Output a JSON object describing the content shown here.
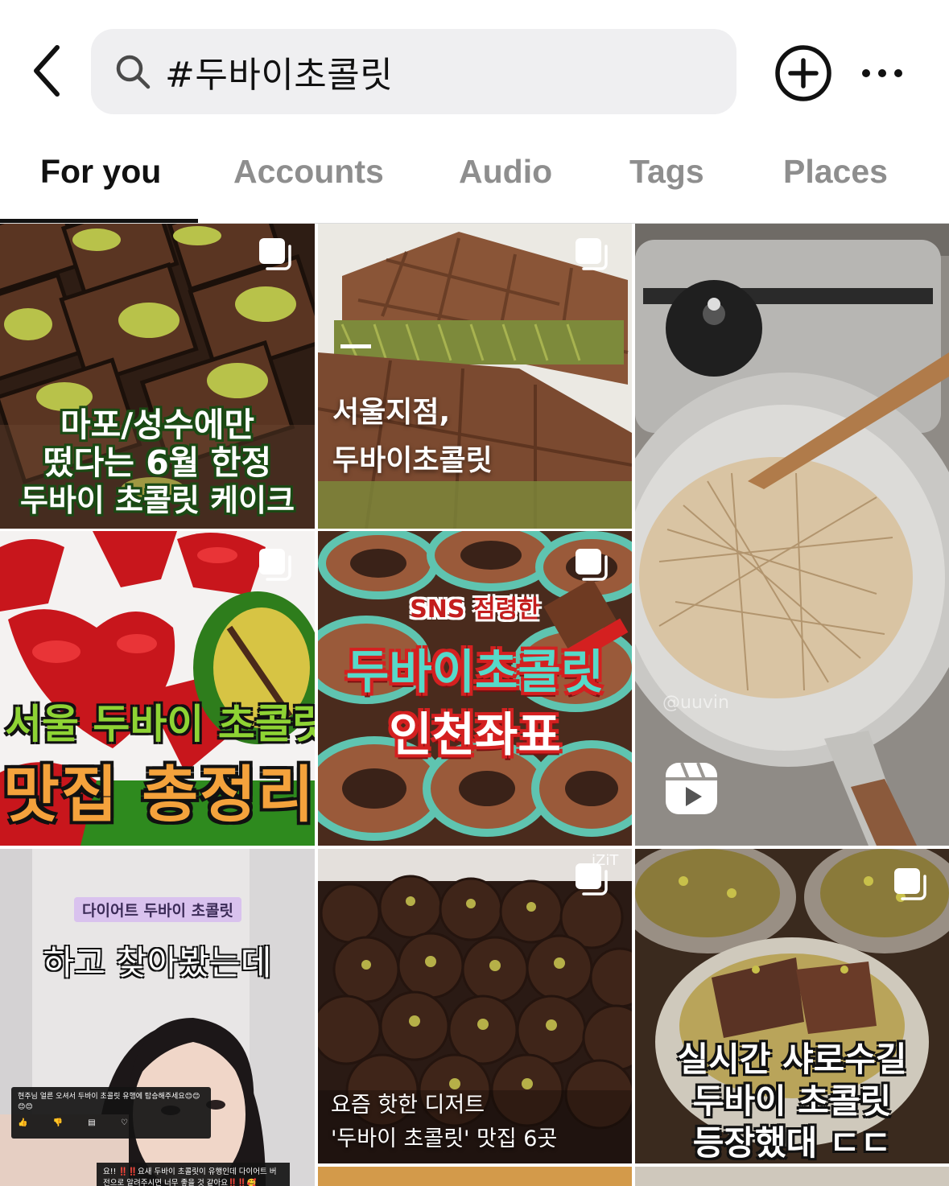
{
  "search": {
    "query": "#두바이초콜릿"
  },
  "icons": {
    "back": "chevron-left-icon",
    "search": "search-icon",
    "new_post": "plus-circle-icon",
    "more": "more-horizontal-icon",
    "carousel": "carousel-icon",
    "reel": "reel-icon"
  },
  "tabs": [
    {
      "label": "For you",
      "active": true
    },
    {
      "label": "Accounts",
      "active": false
    },
    {
      "label": "Audio",
      "active": false
    },
    {
      "label": "Tags",
      "active": false
    },
    {
      "label": "Places",
      "active": false
    }
  ],
  "colors": {
    "search_bg": "#efeff1",
    "active_tab": "#111111",
    "inactive_tab": "#8e8e8e"
  },
  "posts": [
    {
      "type": "carousel",
      "caption_lines": [
        "마포/성수에만",
        "떴다는 6월 한정",
        "두바이 초콜릿 케이크"
      ]
    },
    {
      "type": "carousel",
      "caption_lines": [
        "서울지점,",
        "두바이초콜릿"
      ]
    },
    {
      "type": "reel",
      "watermark": "@uuvin"
    },
    {
      "type": "carousel",
      "caption_lines": [
        "서울 두바이 초콜릿",
        "맛집 총정리"
      ]
    },
    {
      "type": "carousel",
      "caption_lines": [
        "SNS 점령한",
        "두바이초콜릿",
        "인천좌표"
      ]
    },
    {
      "type": "video",
      "tag": "다이어트 두바이 초콜릿",
      "caption_lines": [
        "하고 찾아봤는데"
      ],
      "comment_1": "현주님 얼른 오셔서 두바이 초콜릿 유행에 탑승해주세요😊😊😊😊",
      "comment_2": "요!! ‼️‼️요새 두바이 초콜릿이 유행인데 다이어트 버전으로 알려주시면 너무 좋을 것 같아요‼️‼️🥰"
    },
    {
      "type": "carousel",
      "watermark": "iZiT",
      "caption_lines": [
        "요즘 핫한 디저트",
        "'두바이 초콜릿' 맛집 6곳"
      ]
    },
    {
      "type": "carousel",
      "caption_lines": [
        "실시간 샤로수길",
        "두바이 초콜릿",
        "등장했대 ㄷㄷ"
      ]
    }
  ]
}
